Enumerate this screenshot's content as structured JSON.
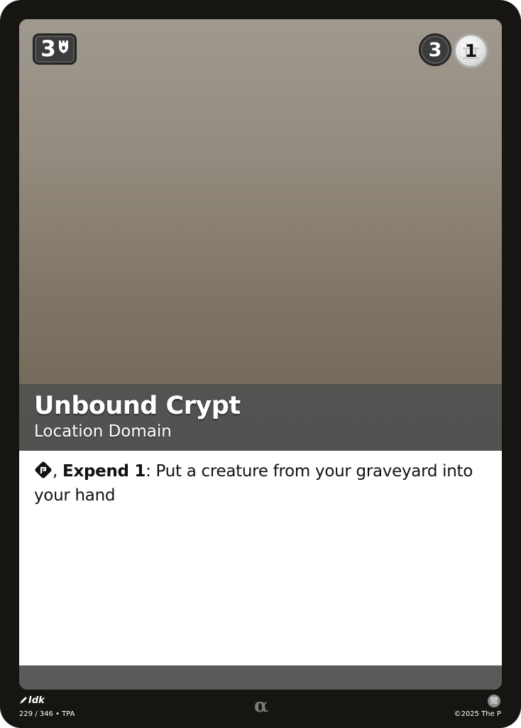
{
  "card": {
    "cost": "3",
    "cost_icon": "tower-icon",
    "stat_dark": "3",
    "stat_light": "1",
    "stat_light_icon": "faction-symbol-icon",
    "name": "Unbound Crypt",
    "type_line": "Location Domain",
    "rules": {
      "symbol_icon": "tap-cost-icon",
      "separator": ", ",
      "keyword": "Expend 1",
      "colon": ":",
      "text": " Put a creature from your graveyard into your hand"
    }
  },
  "footer": {
    "artist": "Idk",
    "artist_icon": "brush-icon",
    "collector_line": "229 / 346 • TPA",
    "rarity_mark": "α",
    "set_icon_glyph": "閒",
    "copyright": "©2025 The P"
  },
  "colors": {
    "card_border": "#171512",
    "art_top": "#a0998f",
    "art_bottom": "#6e6454",
    "title_band": "#505050",
    "rules_background": "#ffffff",
    "bottom_bar": "#5a5a5a"
  }
}
